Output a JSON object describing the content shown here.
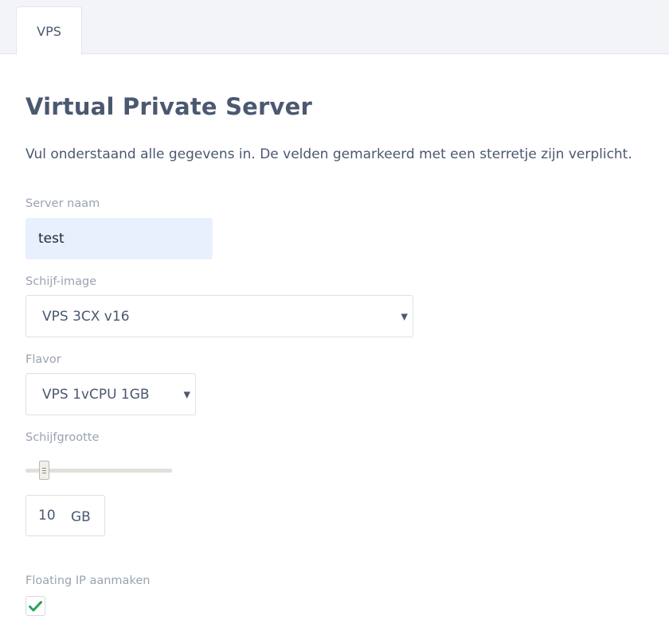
{
  "tabs": [
    {
      "label": "VPS",
      "active": true
    }
  ],
  "page": {
    "title": "Virtual Private Server",
    "intro": "Vul onderstaand alle gegevens in. De velden gemarkeerd met een sterretje zijn verplicht."
  },
  "form": {
    "server_name": {
      "label": "Server naam",
      "value": "test"
    },
    "disk_image": {
      "label": "Schijf-image",
      "value": "VPS 3CX v16"
    },
    "flavor": {
      "label": "Flavor",
      "value": "VPS 1vCPU 1GB"
    },
    "disk_size": {
      "label": "Schijfgrootte",
      "value": "10",
      "unit": "GB",
      "slider_fraction": 0.1
    },
    "floating_ip": {
      "label": "Floating IP aanmaken",
      "checked": true
    }
  },
  "colors": {
    "text": "#4b5871",
    "label": "#9aa2b1",
    "input_fill": "#e8f0fe",
    "check": "#2aa35a"
  },
  "icons": {
    "select_caret": "caret-down-icon",
    "checkmark": "checkmark-icon",
    "slider_grip": "grip-icon"
  }
}
